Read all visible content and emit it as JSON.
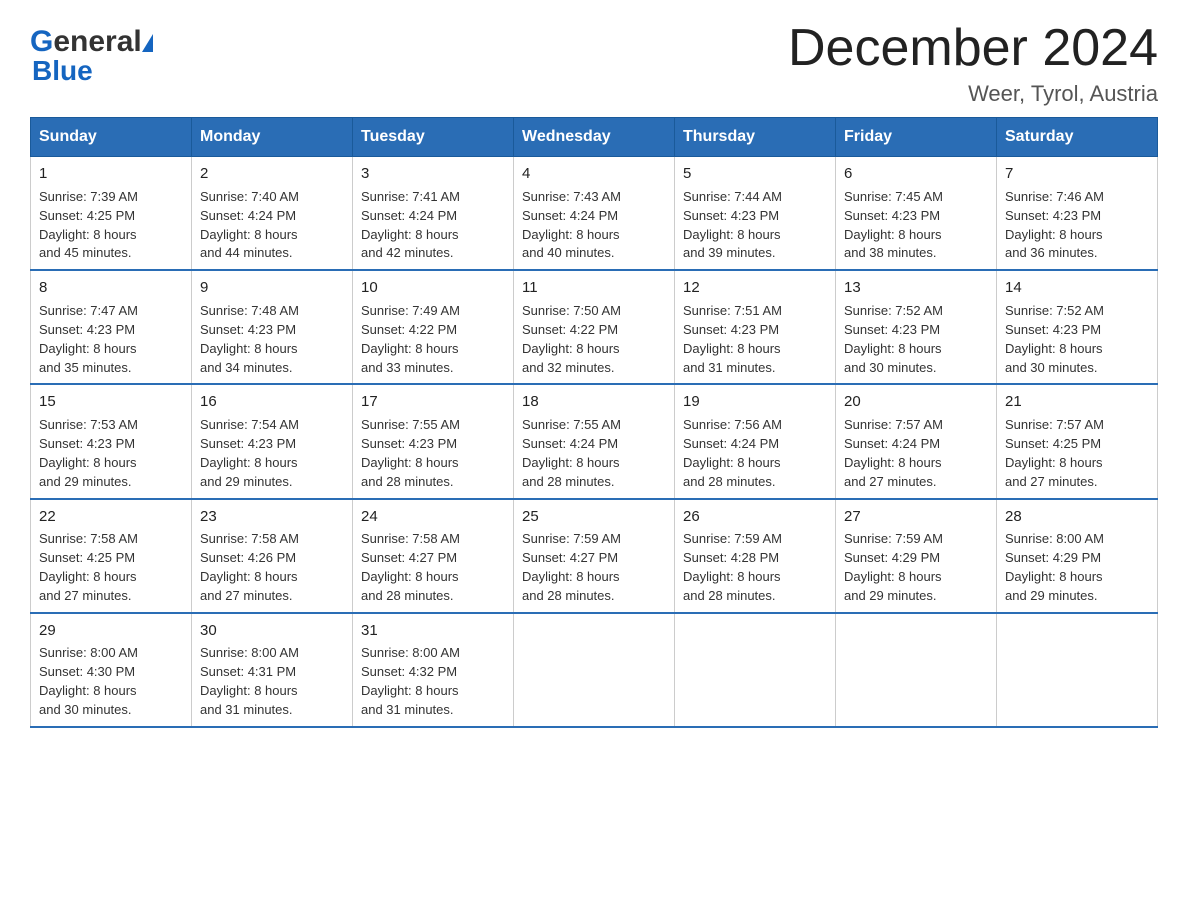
{
  "logo": {
    "general": "General",
    "blue": "Blue"
  },
  "title": "December 2024",
  "subtitle": "Weer, Tyrol, Austria",
  "days_of_week": [
    "Sunday",
    "Monday",
    "Tuesday",
    "Wednesday",
    "Thursday",
    "Friday",
    "Saturday"
  ],
  "weeks": [
    [
      {
        "day": "1",
        "sunrise": "7:39 AM",
        "sunset": "4:25 PM",
        "daylight": "8 hours and 45 minutes."
      },
      {
        "day": "2",
        "sunrise": "7:40 AM",
        "sunset": "4:24 PM",
        "daylight": "8 hours and 44 minutes."
      },
      {
        "day": "3",
        "sunrise": "7:41 AM",
        "sunset": "4:24 PM",
        "daylight": "8 hours and 42 minutes."
      },
      {
        "day": "4",
        "sunrise": "7:43 AM",
        "sunset": "4:24 PM",
        "daylight": "8 hours and 40 minutes."
      },
      {
        "day": "5",
        "sunrise": "7:44 AM",
        "sunset": "4:23 PM",
        "daylight": "8 hours and 39 minutes."
      },
      {
        "day": "6",
        "sunrise": "7:45 AM",
        "sunset": "4:23 PM",
        "daylight": "8 hours and 38 minutes."
      },
      {
        "day": "7",
        "sunrise": "7:46 AM",
        "sunset": "4:23 PM",
        "daylight": "8 hours and 36 minutes."
      }
    ],
    [
      {
        "day": "8",
        "sunrise": "7:47 AM",
        "sunset": "4:23 PM",
        "daylight": "8 hours and 35 minutes."
      },
      {
        "day": "9",
        "sunrise": "7:48 AM",
        "sunset": "4:23 PM",
        "daylight": "8 hours and 34 minutes."
      },
      {
        "day": "10",
        "sunrise": "7:49 AM",
        "sunset": "4:22 PM",
        "daylight": "8 hours and 33 minutes."
      },
      {
        "day": "11",
        "sunrise": "7:50 AM",
        "sunset": "4:22 PM",
        "daylight": "8 hours and 32 minutes."
      },
      {
        "day": "12",
        "sunrise": "7:51 AM",
        "sunset": "4:23 PM",
        "daylight": "8 hours and 31 minutes."
      },
      {
        "day": "13",
        "sunrise": "7:52 AM",
        "sunset": "4:23 PM",
        "daylight": "8 hours and 30 minutes."
      },
      {
        "day": "14",
        "sunrise": "7:52 AM",
        "sunset": "4:23 PM",
        "daylight": "8 hours and 30 minutes."
      }
    ],
    [
      {
        "day": "15",
        "sunrise": "7:53 AM",
        "sunset": "4:23 PM",
        "daylight": "8 hours and 29 minutes."
      },
      {
        "day": "16",
        "sunrise": "7:54 AM",
        "sunset": "4:23 PM",
        "daylight": "8 hours and 29 minutes."
      },
      {
        "day": "17",
        "sunrise": "7:55 AM",
        "sunset": "4:23 PM",
        "daylight": "8 hours and 28 minutes."
      },
      {
        "day": "18",
        "sunrise": "7:55 AM",
        "sunset": "4:24 PM",
        "daylight": "8 hours and 28 minutes."
      },
      {
        "day": "19",
        "sunrise": "7:56 AM",
        "sunset": "4:24 PM",
        "daylight": "8 hours and 28 minutes."
      },
      {
        "day": "20",
        "sunrise": "7:57 AM",
        "sunset": "4:24 PM",
        "daylight": "8 hours and 27 minutes."
      },
      {
        "day": "21",
        "sunrise": "7:57 AM",
        "sunset": "4:25 PM",
        "daylight": "8 hours and 27 minutes."
      }
    ],
    [
      {
        "day": "22",
        "sunrise": "7:58 AM",
        "sunset": "4:25 PM",
        "daylight": "8 hours and 27 minutes."
      },
      {
        "day": "23",
        "sunrise": "7:58 AM",
        "sunset": "4:26 PM",
        "daylight": "8 hours and 27 minutes."
      },
      {
        "day": "24",
        "sunrise": "7:58 AM",
        "sunset": "4:27 PM",
        "daylight": "8 hours and 28 minutes."
      },
      {
        "day": "25",
        "sunrise": "7:59 AM",
        "sunset": "4:27 PM",
        "daylight": "8 hours and 28 minutes."
      },
      {
        "day": "26",
        "sunrise": "7:59 AM",
        "sunset": "4:28 PM",
        "daylight": "8 hours and 28 minutes."
      },
      {
        "day": "27",
        "sunrise": "7:59 AM",
        "sunset": "4:29 PM",
        "daylight": "8 hours and 29 minutes."
      },
      {
        "day": "28",
        "sunrise": "8:00 AM",
        "sunset": "4:29 PM",
        "daylight": "8 hours and 29 minutes."
      }
    ],
    [
      {
        "day": "29",
        "sunrise": "8:00 AM",
        "sunset": "4:30 PM",
        "daylight": "8 hours and 30 minutes."
      },
      {
        "day": "30",
        "sunrise": "8:00 AM",
        "sunset": "4:31 PM",
        "daylight": "8 hours and 31 minutes."
      },
      {
        "day": "31",
        "sunrise": "8:00 AM",
        "sunset": "4:32 PM",
        "daylight": "8 hours and 31 minutes."
      },
      null,
      null,
      null,
      null
    ]
  ],
  "labels": {
    "sunrise": "Sunrise:",
    "sunset": "Sunset:",
    "daylight": "Daylight:"
  }
}
